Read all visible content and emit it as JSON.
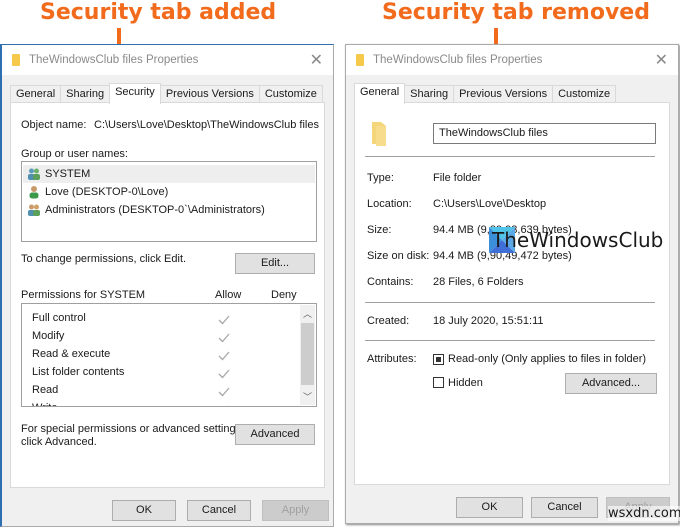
{
  "captions": {
    "left": "Security tab added",
    "right": "Security tab removed"
  },
  "accent_color": "#f26a1b",
  "left_window": {
    "title": "TheWindowsClub files Properties",
    "tabs": [
      {
        "label": "General",
        "active": false
      },
      {
        "label": "Sharing",
        "active": false
      },
      {
        "label": "Security",
        "active": true
      },
      {
        "label": "Previous Versions",
        "active": false
      },
      {
        "label": "Customize",
        "active": false
      }
    ],
    "object_name_label": "Object name:",
    "object_name_value": "C:\\Users\\Love\\Desktop\\TheWindowsClub files",
    "group_label": "Group or user names:",
    "users": [
      {
        "name": "SYSTEM",
        "icon": "group-users-icon",
        "selected": true
      },
      {
        "name": "Love (DESKTOP-0\\Love)",
        "icon": "single-user-icon",
        "selected": false
      },
      {
        "name": "Administrators (DESKTOP-0`\\Administrators)",
        "icon": "group-users-icon",
        "selected": false
      }
    ],
    "change_text": "To change permissions, click Edit.",
    "edit_button": "Edit...",
    "permissions_label": "Permissions for SYSTEM",
    "allow_label": "Allow",
    "deny_label": "Deny",
    "permissions": [
      {
        "name": "Full control",
        "allow": true,
        "deny": false
      },
      {
        "name": "Modify",
        "allow": true,
        "deny": false
      },
      {
        "name": "Read & execute",
        "allow": true,
        "deny": false
      },
      {
        "name": "List folder contents",
        "allow": true,
        "deny": false
      },
      {
        "name": "Read",
        "allow": true,
        "deny": false
      },
      {
        "name": "Write",
        "allow": true,
        "deny": false
      }
    ],
    "advanced_text_1": "For special permissions or advanced settings,",
    "advanced_text_2": "click Advanced.",
    "advanced_button": "Advanced",
    "ok_button": "OK",
    "cancel_button": "Cancel",
    "apply_button": "Apply"
  },
  "right_window": {
    "title": "TheWindowsClub files Properties",
    "tabs": [
      {
        "label": "General",
        "active": true
      },
      {
        "label": "Sharing",
        "active": false
      },
      {
        "label": "Previous Versions",
        "active": false
      },
      {
        "label": "Customize",
        "active": false
      }
    ],
    "folder_name": "TheWindowsClub files",
    "fields": [
      {
        "label": "Type:",
        "value": "File folder"
      },
      {
        "label": "Location:",
        "value": "C:\\Users\\Love\\Desktop"
      },
      {
        "label": "Size:",
        "value": "94.4 MB (9,89,93,639 bytes)"
      },
      {
        "label": "Size on disk:",
        "value": "94.4 MB (9,90,49,472 bytes)"
      },
      {
        "label": "Contains:",
        "value": "28 Files, 6 Folders"
      },
      {
        "label": "Created:",
        "value": "18 July 2020, 15:51:11"
      }
    ],
    "attributes_label": "Attributes:",
    "readonly_label": "Read-only (Only applies to files in folder)",
    "readonly_state": "indeterminate",
    "hidden_label": "Hidden",
    "hidden_checked": false,
    "advanced_button": "Advanced...",
    "ok_button": "OK",
    "cancel_button": "Cancel",
    "apply_button": "Apply"
  },
  "watermarks": {
    "brand": "TheWindowsClub",
    "site": "wsxdn.com"
  }
}
